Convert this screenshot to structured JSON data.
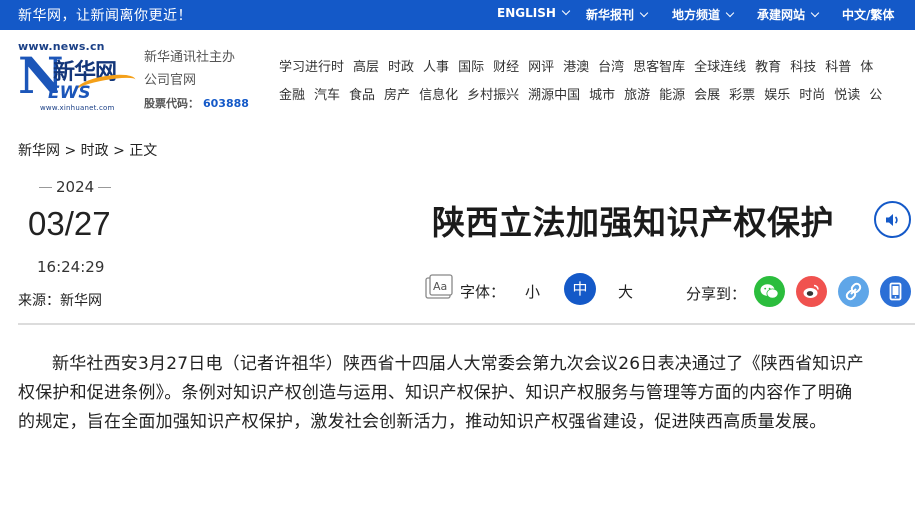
{
  "topbar": {
    "tagline": "新华网，让新闻离你更近！",
    "nav": [
      "ENGLISH",
      "新华报刊",
      "地方频道",
      "承建网站",
      "中文/繁体"
    ]
  },
  "logo": {
    "url": "www.news.cn",
    "cn_name": "新华网",
    "letters": "EWS",
    "sub_url": "www.xinhuanet.com"
  },
  "official": {
    "line1": "新华通讯社主办",
    "line2": "公司官网",
    "stock_label": "股票代码：",
    "stock_code": "603888"
  },
  "channels": {
    "row1": [
      "学习进行时",
      "高层",
      "时政",
      "人事",
      "国际",
      "财经",
      "网评",
      "港澳",
      "台湾",
      "思客智库",
      "全球连线",
      "教育",
      "科技",
      "科普",
      "体"
    ],
    "row2": [
      "金融",
      "汽车",
      "食品",
      "房产",
      "信息化",
      "乡村振兴",
      "溯源中国",
      "城市",
      "旅游",
      "能源",
      "会展",
      "彩票",
      "娱乐",
      "时尚",
      "悦读",
      "公"
    ]
  },
  "breadcrumb": "新华网 > 时政 > 正文",
  "date": {
    "year": "2024",
    "month_day": "03/27",
    "time": "16:24:29"
  },
  "source": "来源：新华网",
  "article": {
    "title": "陕西立法加强知识产权保护",
    "body": "新华社西安3月27日电（记者许祖华）陕西省十四届人大常委会第九次会议26日表决通过了《陕西省知识产权保护和促进条例》。条例对知识产权创造与运用、知识产权保护、知识产权服务与管理等方面的内容作了明确的规定，旨在全面加强知识产权保护，激发社会创新活力，推动知识产权强省建设，促进陕西高质量发展。"
  },
  "font_controls": {
    "label": "字体：",
    "small": "小",
    "medium": "中",
    "large": "大",
    "active": "中"
  },
  "share": {
    "label": "分享到：",
    "icons": [
      "wechat-icon",
      "weibo-icon",
      "link-icon",
      "mobile-icon"
    ]
  },
  "colors": {
    "brand_blue": "#1459c8",
    "wechat": "#2bbd3d",
    "weibo": "#f0524f",
    "link": "#5fa6e8",
    "mobile": "#2b6fd6"
  }
}
